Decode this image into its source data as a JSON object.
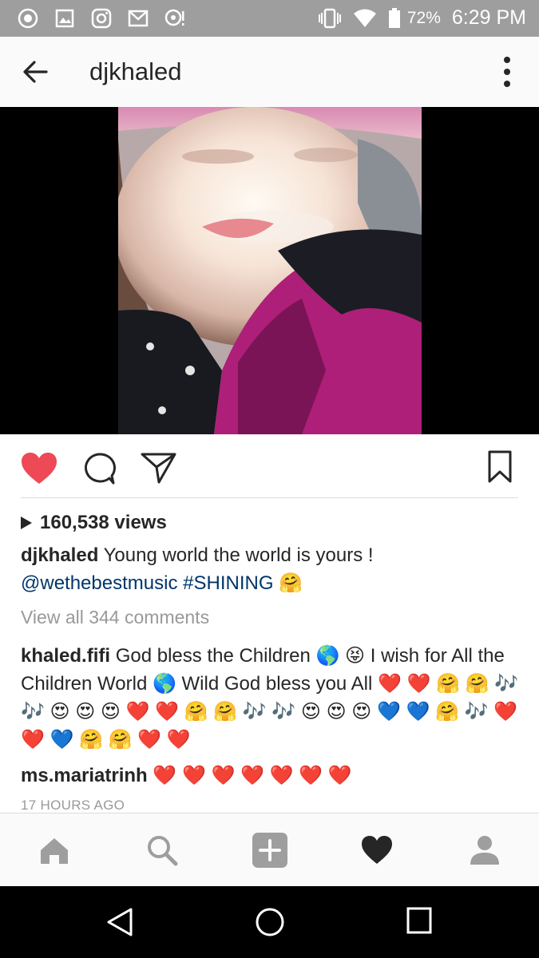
{
  "status_bar": {
    "battery": "72%",
    "time": "6:29 PM"
  },
  "header": {
    "username": "djkhaled"
  },
  "post": {
    "views": "160,538 views",
    "caption_user": "djkhaled",
    "caption_text": "Young world the world is yours !",
    "caption_mention": "@wethebestmusic",
    "caption_hashtag": "#SHINING",
    "caption_emoji": "🤗",
    "view_all": "View all 344 comments",
    "comments": [
      {
        "user": "khaled.fifi",
        "text": "God bless the Children 🌎 😝 I wish for All the Children World 🌎 Wild God bless you All ❤️ ❤️ 🤗 🤗 🎶 🎶 😍 😍 😍 ❤️ ❤️ 🤗 🤗 🎶 🎶 😍 😍 😍 💙 💙 🤗 🎶 ❤️ ❤️ 💙 🤗 🤗 ❤️ ❤️"
      },
      {
        "user": "ms.mariatrinh",
        "text": "❤️ ❤️ ❤️ ❤️ ❤️ ❤️ ❤️"
      }
    ],
    "timestamp": "17 HOURS AGO"
  },
  "colors": {
    "like_red": "#ed4956",
    "link_blue": "#003569",
    "status_bar": "#9e9e9e"
  },
  "icons": {
    "status_left": [
      "browser-icon",
      "gallery-icon",
      "instagram-icon",
      "gmail-icon",
      "notification-icon"
    ],
    "status_right": [
      "vibrate-icon",
      "wifi-icon",
      "battery-icon"
    ],
    "actions": [
      "heart-filled-icon",
      "comment-icon",
      "share-icon",
      "bookmark-icon"
    ],
    "tabs": [
      "home-icon",
      "search-icon",
      "add-icon",
      "activity-heart-icon",
      "profile-icon"
    ],
    "android_nav": [
      "back-triangle-icon",
      "home-circle-icon",
      "recents-square-icon"
    ]
  }
}
